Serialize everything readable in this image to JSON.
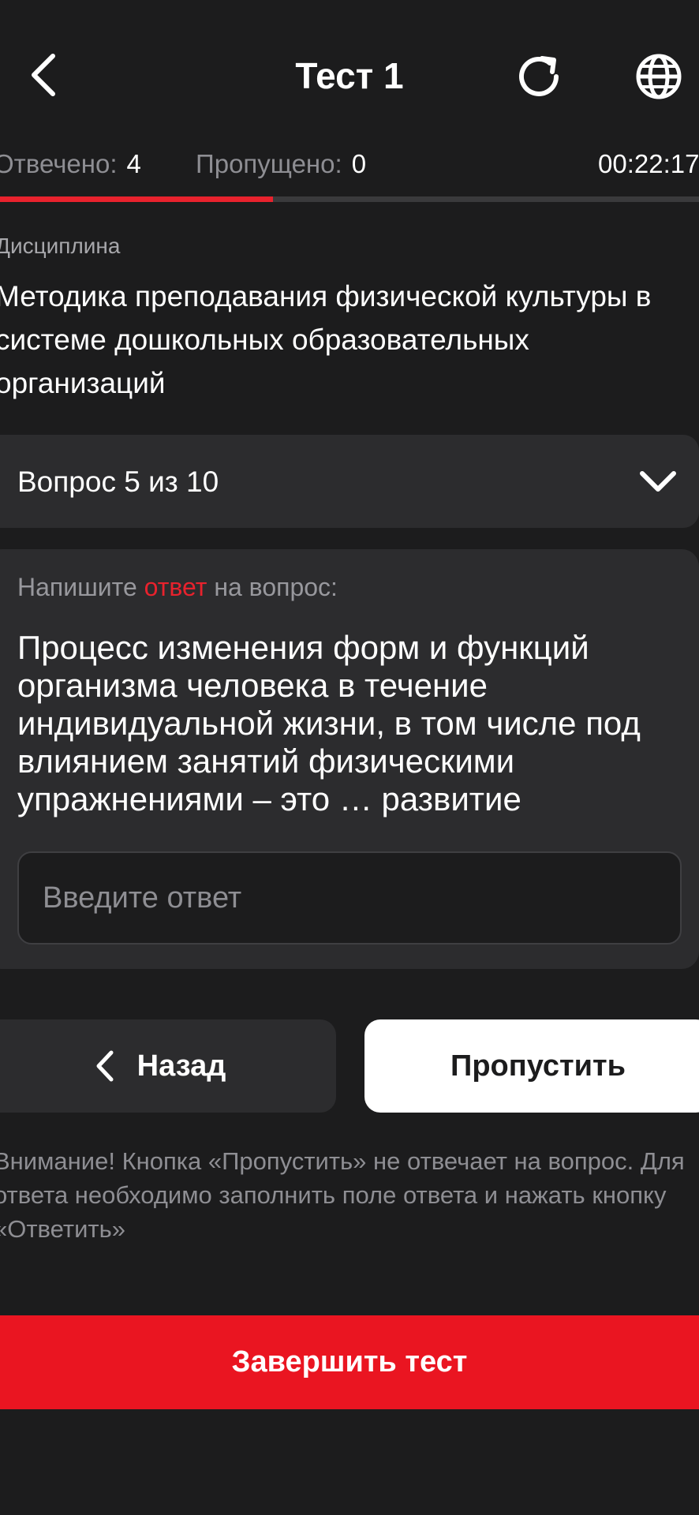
{
  "header": {
    "title": "Тест 1",
    "back_icon": "chevron-left-icon",
    "refresh_icon": "refresh-icon",
    "language_icon": "globe-icon"
  },
  "stats": {
    "answered_label": "Отвечено:",
    "answered_value": "4",
    "skipped_label": "Пропущено:",
    "skipped_value": "0",
    "timer": "00:22:17"
  },
  "progress": {
    "fraction": 0.39
  },
  "discipline": {
    "label": "Дисциплина",
    "name": "Методика преподавания физической культуры в системе дошкольных образовательных организаций"
  },
  "question_selector": {
    "label": "Вопрос 5 из 10",
    "icon": "chevron-down-icon"
  },
  "question": {
    "prompt_before": "Напишите ",
    "prompt_accent": "ответ",
    "prompt_after": " на вопрос:",
    "text": "Процесс изменения форм и функций организма человека в течение индивидуальной жизни, в том числе под влиянием занятий физическими упражнениями – это … развитие",
    "answer_value": "",
    "answer_placeholder": "Введите ответ"
  },
  "navigation": {
    "back_label": "Назад",
    "skip_label": "Пропустить"
  },
  "notice": "Внимание! Кнопка «Пропустить» не отвечает на вопрос. Для ответа необходимо заполнить поле ответа и нажать кнопку «Ответить»",
  "finish_label": "Завершить тест",
  "colors": {
    "background": "#1c1c1d",
    "card": "#2c2c2e",
    "accent": "#e8222d",
    "finish_button": "#ea1521"
  }
}
